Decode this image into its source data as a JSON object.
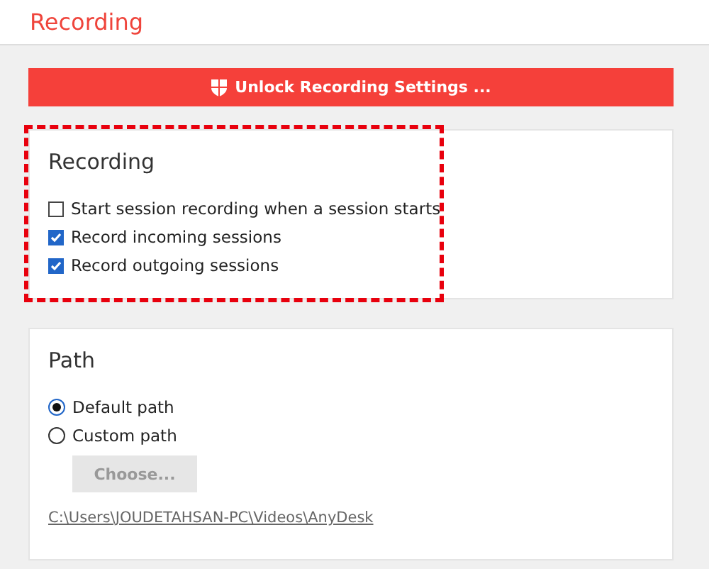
{
  "header": {
    "title": "Recording"
  },
  "unlock_button": {
    "label": "Unlock Recording Settings ..."
  },
  "recording": {
    "title": "Recording",
    "highlighted": true,
    "options": [
      {
        "label": "Start session recording when a session starts",
        "checked": false
      },
      {
        "label": "Record incoming sessions",
        "checked": true
      },
      {
        "label": "Record outgoing sessions",
        "checked": true
      }
    ]
  },
  "path": {
    "title": "Path",
    "options": [
      {
        "label": "Default path",
        "selected": true
      },
      {
        "label": "Custom path",
        "selected": false
      }
    ],
    "choose_button": {
      "label": "Choose...",
      "disabled": true
    },
    "link": "C:\\Users\\JOUDETAHSAN-PC\\Videos\\AnyDesk"
  }
}
